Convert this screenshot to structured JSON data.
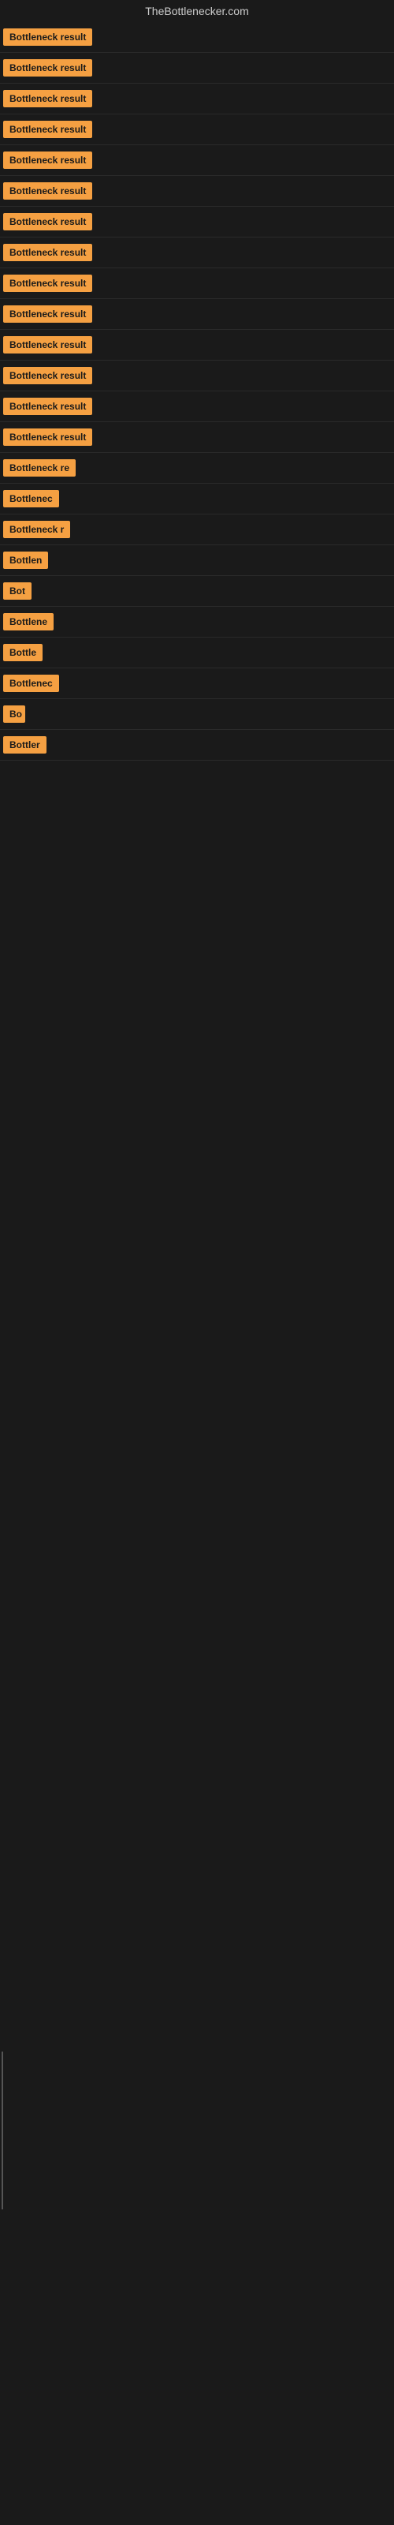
{
  "site": {
    "title": "TheBottlenecker.com"
  },
  "items": [
    {
      "id": 1,
      "label": "Bottleneck result",
      "badge_width": 130
    },
    {
      "id": 2,
      "label": "Bottleneck result",
      "badge_width": 130
    },
    {
      "id": 3,
      "label": "Bottleneck result",
      "badge_width": 130
    },
    {
      "id": 4,
      "label": "Bottleneck result",
      "badge_width": 130
    },
    {
      "id": 5,
      "label": "Bottleneck result",
      "badge_width": 130
    },
    {
      "id": 6,
      "label": "Bottleneck result",
      "badge_width": 130
    },
    {
      "id": 7,
      "label": "Bottleneck result",
      "badge_width": 130
    },
    {
      "id": 8,
      "label": "Bottleneck result",
      "badge_width": 130
    },
    {
      "id": 9,
      "label": "Bottleneck result",
      "badge_width": 130
    },
    {
      "id": 10,
      "label": "Bottleneck result",
      "badge_width": 130
    },
    {
      "id": 11,
      "label": "Bottleneck result",
      "badge_width": 130
    },
    {
      "id": 12,
      "label": "Bottleneck result",
      "badge_width": 130
    },
    {
      "id": 13,
      "label": "Bottleneck result",
      "badge_width": 130
    },
    {
      "id": 14,
      "label": "Bottleneck result",
      "badge_width": 130
    },
    {
      "id": 15,
      "label": "Bottleneck re",
      "badge_width": 105
    },
    {
      "id": 16,
      "label": "Bottlenec",
      "badge_width": 80
    },
    {
      "id": 17,
      "label": "Bottleneck r",
      "badge_width": 90
    },
    {
      "id": 18,
      "label": "Bottlen",
      "badge_width": 68
    },
    {
      "id": 19,
      "label": "Bot",
      "badge_width": 38
    },
    {
      "id": 20,
      "label": "Bottlene",
      "badge_width": 72
    },
    {
      "id": 21,
      "label": "Bottle",
      "badge_width": 55
    },
    {
      "id": 22,
      "label": "Bottlenec",
      "badge_width": 78
    },
    {
      "id": 23,
      "label": "Bo",
      "badge_width": 28
    },
    {
      "id": 24,
      "label": "Bottler",
      "badge_width": 60
    }
  ]
}
